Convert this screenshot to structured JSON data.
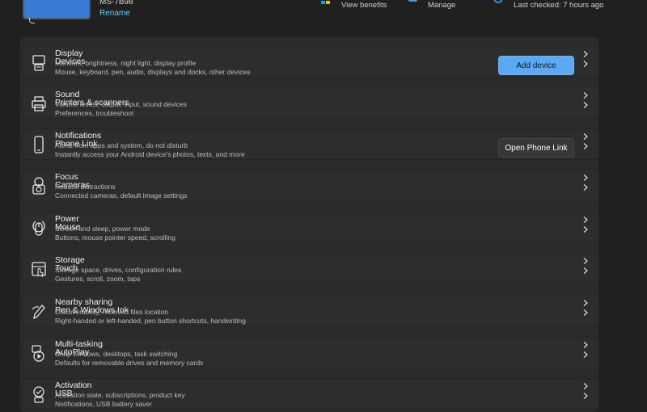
{
  "header": {
    "pc_name": "MS-7B98",
    "rename_label": "Rename",
    "items": [
      {
        "label": "View benefits"
      },
      {
        "label": "Manage"
      },
      {
        "label": "Last checked: 7 hours ago"
      }
    ]
  },
  "rows": [
    {
      "back_title": "Display",
      "back_sub": "Monitors, brightness, night light, display profile",
      "title": "Devices",
      "sub": "Mouse, keyboard, pen, audio, displays and docks, other devices",
      "button": "Add device",
      "button_style": "primary"
    },
    {
      "back_title": "Sound",
      "back_sub": "Volume levels, output, input, sound devices",
      "title": "Printers & scanners",
      "sub": "Preferences, troubleshoot"
    },
    {
      "back_title": "Notifications",
      "back_sub": "Alerts from apps and system, do not disturb",
      "title": "Phone Link",
      "sub": "Instantly access your Android device's photos, texts, and more",
      "button": "Open Phone Link",
      "button_style": "secondary"
    },
    {
      "back_title": "Focus",
      "back_sub": "Reduce distractions",
      "title": "Cameras",
      "sub": "Connected cameras, default image settings"
    },
    {
      "back_title": "Power",
      "back_sub": "Screen and sleep, power mode",
      "title": "Mouse",
      "sub": "Buttons, mouse pointer speed, scrolling"
    },
    {
      "back_title": "Storage",
      "back_sub": "Storage space, drives, configuration rules",
      "title": "Touch",
      "sub": "Gestures, scroll, zoom, taps"
    },
    {
      "back_title": "Nearby sharing",
      "back_sub": "Discoverability, received files location",
      "title": "Pen & Windows Ink",
      "sub": "Right-handed or left-handed, pen button shortcuts, handwriting"
    },
    {
      "back_title": "Multi-tasking",
      "back_sub": "Snap windows, desktops, task switching",
      "title": "AutoPlay",
      "sub": "Defaults for removable drives and memory cards"
    },
    {
      "back_title": "Activation",
      "back_sub": "Activation state, subscriptions, product key",
      "title": "USB",
      "sub": "Notifications, USB battery saver"
    }
  ],
  "icons": [
    "display-devices-icon",
    "sound-printer-icon",
    "notifications-phone-icon",
    "focus-camera-icon",
    "power-mouse-icon",
    "storage-touch-icon",
    "share-pen-icon",
    "multitask-autoplay-icon",
    "activation-usb-icon"
  ],
  "colors": {
    "accent": "#60cdff",
    "button_primary": "#5aa9f2",
    "background": "#202020",
    "card": "#2d2d2d"
  }
}
